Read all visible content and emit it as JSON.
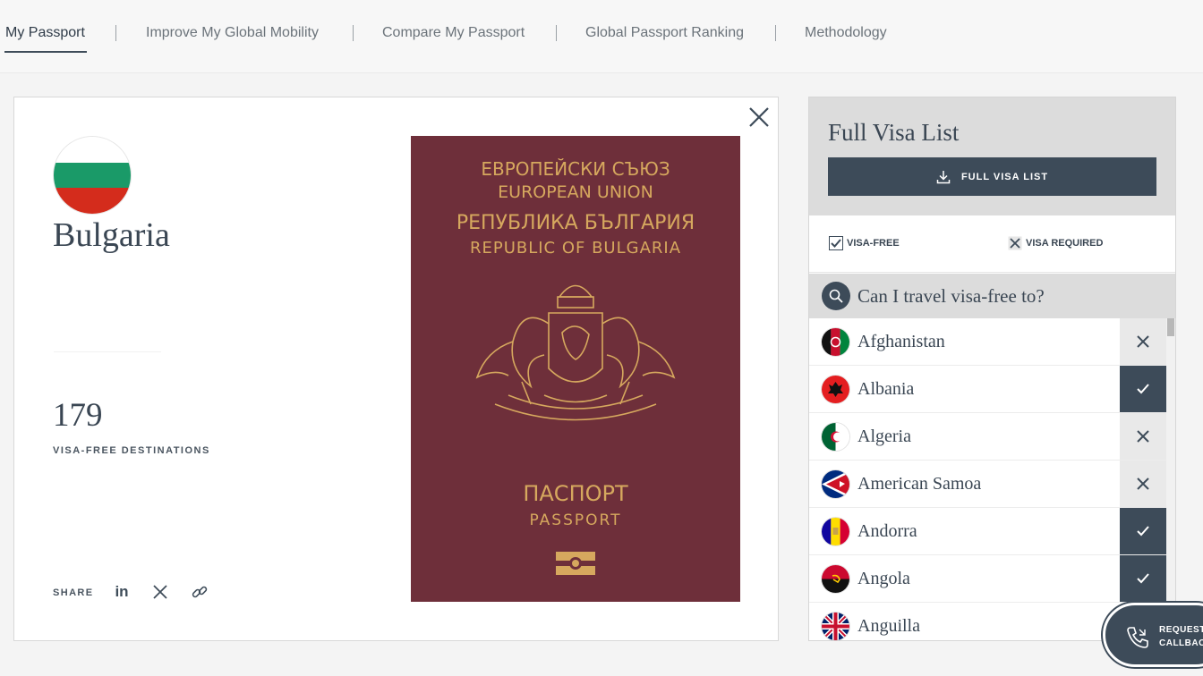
{
  "nav": {
    "tabs": [
      {
        "label": "My Passport",
        "active": true
      },
      {
        "label": "Improve My Global Mobility",
        "active": false
      },
      {
        "label": "Compare My Passport",
        "active": false
      },
      {
        "label": "Global Passport Ranking",
        "active": false
      },
      {
        "label": "Methodology",
        "active": false
      }
    ]
  },
  "passport_card": {
    "country": "Bulgaria",
    "flag_colors": [
      "#ffffff",
      "#1a9a68",
      "#d42c1c"
    ],
    "visa_free_count": "179",
    "visa_free_label": "VISA-FREE DESTINATIONS",
    "share_label": "SHARE",
    "share_icons": [
      "linkedin-icon",
      "x-icon",
      "link-icon"
    ],
    "passport_cover": {
      "line1": "ЕВРОПЕЙСКИ СЪЮЗ",
      "line2": "EUROPEAN UNION",
      "line3": "РЕПУБЛИКА БЪЛГАРИЯ",
      "line4": "REPUBLIC OF BULGARIA",
      "line5": "ПАСПОРТ",
      "line6": "PASSPORT",
      "cover_color": "#6e2f3a",
      "text_color": "#d6a85e"
    }
  },
  "visa_panel": {
    "title": "Full Visa List",
    "download_button": "FULL VISA LIST",
    "legend": {
      "visa_free": "VISA-FREE",
      "visa_required": "VISA REQUIRED"
    },
    "search_placeholder": "Can I travel visa-free to?",
    "countries": [
      {
        "name": "Afghanistan",
        "status": "required"
      },
      {
        "name": "Albania",
        "status": "free"
      },
      {
        "name": "Algeria",
        "status": "required"
      },
      {
        "name": "American Samoa",
        "status": "required"
      },
      {
        "name": "Andorra",
        "status": "free"
      },
      {
        "name": "Angola",
        "status": "free"
      },
      {
        "name": "Anguilla",
        "status": "free"
      }
    ]
  },
  "callback": {
    "line1": "REQUEST",
    "line2": "CALLBACK"
  },
  "colors": {
    "accent_dark": "#3d4b59",
    "panel_grey": "#dcdcdc"
  }
}
